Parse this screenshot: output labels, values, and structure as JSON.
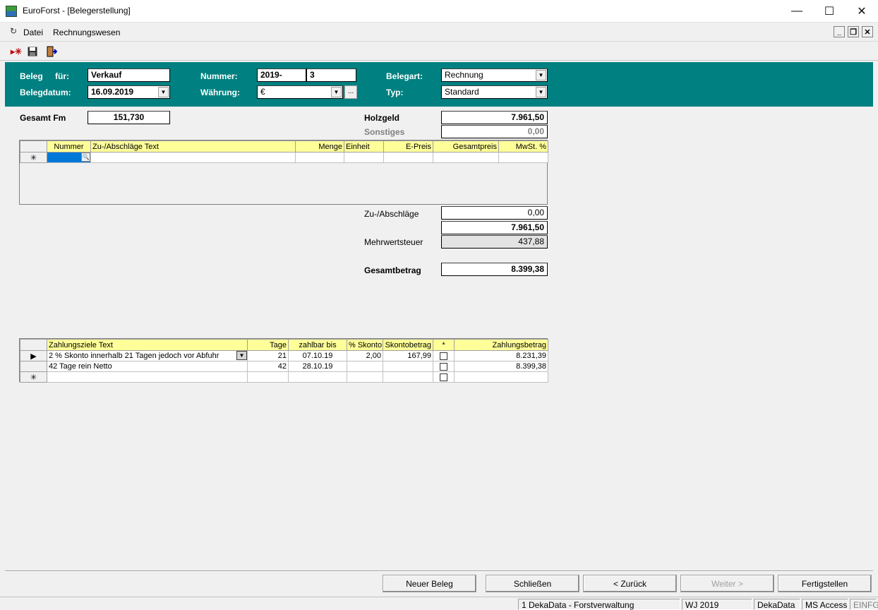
{
  "window": {
    "title": "EuroForst - [Belegerstellung]",
    "minimize": "—",
    "maximize": "☐",
    "close": "✕"
  },
  "menu": {
    "items": [
      "Datei",
      "Rechnungswesen"
    ]
  },
  "mdi": {
    "min": "_",
    "restore": "❐",
    "close": "✕"
  },
  "header": {
    "beleg_label": "Beleg",
    "fuer_label": "für:",
    "fuer_value": "Verkauf",
    "belegdatum_label": "Belegdatum:",
    "belegdatum_value": "16.09.2019",
    "nummer_label": "Nummer:",
    "nummer_prefix": "2019-",
    "nummer_value": "3",
    "waehrung_label": "Währung:",
    "waehrung_value": "€",
    "belegart_label": "Belegart:",
    "belegart_value": "Rechnung",
    "typ_label": "Typ:",
    "typ_value": "Standard"
  },
  "summary": {
    "gesamt_fm_label": "Gesamt  Fm",
    "gesamt_fm_value": "151,730",
    "holzgeld_label": "Holzgeld",
    "holzgeld_value": "7.961,50",
    "sonstiges_label": "Sonstiges",
    "sonstiges_value": "0,00",
    "zuabschlaege_label": "Zu-/Abschläge",
    "zuabschlaege_value": "0,00",
    "zwischensumme_value": "7.961,50",
    "mwst_label": "Mehrwertsteuer",
    "mwst_value": "437,88",
    "gesamtbetrag_label": "Gesamtbetrag",
    "gesamtbetrag_value": "8.399,38"
  },
  "adjustments_grid": {
    "columns": [
      "Nummer",
      "Zu-/Abschläge Text",
      "Menge",
      "Einheit",
      "E-Preis",
      "Gesamtpreis",
      "MwSt. %"
    ],
    "new_row_marker": "✳"
  },
  "payment_grid": {
    "columns": [
      "Zahlungsziele Text",
      "Tage",
      "zahlbar bis",
      "% Skonto",
      "Skontobetrag",
      "*",
      "Zahlungsbetrag"
    ],
    "rows": [
      {
        "marker": "▶",
        "text": "2 % Skonto innerhalb 21 Tagen jedoch vor Abfuhr",
        "tage": "21",
        "zahlbar_bis": "07.10.19",
        "skonto": "2,00",
        "skontobetrag": "167,99",
        "zahlungsbetrag": "8.231,39"
      },
      {
        "marker": "",
        "text": "42 Tage rein Netto",
        "tage": "42",
        "zahlbar_bis": "28.10.19",
        "skonto": "",
        "skontobetrag": "",
        "zahlungsbetrag": "8.399,38"
      }
    ],
    "new_row_marker": "✳"
  },
  "buttons": {
    "neuer_beleg": "Neuer Beleg",
    "schliessen": "Schließen",
    "zurueck": "< Zurück",
    "weiter": "Weiter >",
    "fertigstellen": "Fertigstellen"
  },
  "status": {
    "db": "1 DekaData - Forstverwaltung",
    "wj": "WJ 2019",
    "user": "DekaData",
    "app": "MS Access",
    "mode": "EINFG"
  },
  "colors": {
    "header_bg": "#008080",
    "grid_header_bg": "#ffff99"
  }
}
